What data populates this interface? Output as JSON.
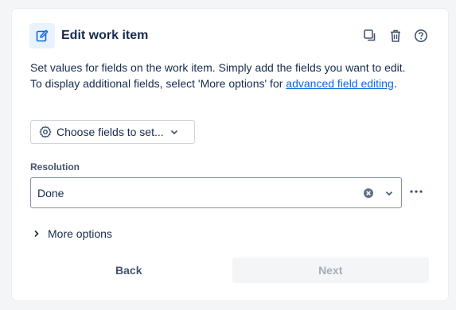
{
  "header": {
    "title": "Edit work item",
    "icons": [
      "edit-icon",
      "copy-icon",
      "trash-icon",
      "help-icon"
    ]
  },
  "description": {
    "line1": "Set values for fields on the work item. Simply add the fields you want to edit.",
    "line2_prefix": "To display additional fields, select 'More options' for ",
    "line2_link": "advanced field editing",
    "line2_suffix": "."
  },
  "choose_fields": {
    "label": "Choose fields to set...",
    "icons": [
      "gear-icon",
      "chevron-down-icon"
    ]
  },
  "resolution": {
    "label": "Resolution",
    "value": "Done"
  },
  "more_options": {
    "label": "More options"
  },
  "footer": {
    "back_label": "Back",
    "next_label": "Next"
  },
  "colors": {
    "accent": "#0c66e4",
    "icon_bg": "#e9f2ff",
    "text": "#172b4d",
    "disabled_text": "#a5adba",
    "disabled_bg": "#f4f5f7"
  }
}
